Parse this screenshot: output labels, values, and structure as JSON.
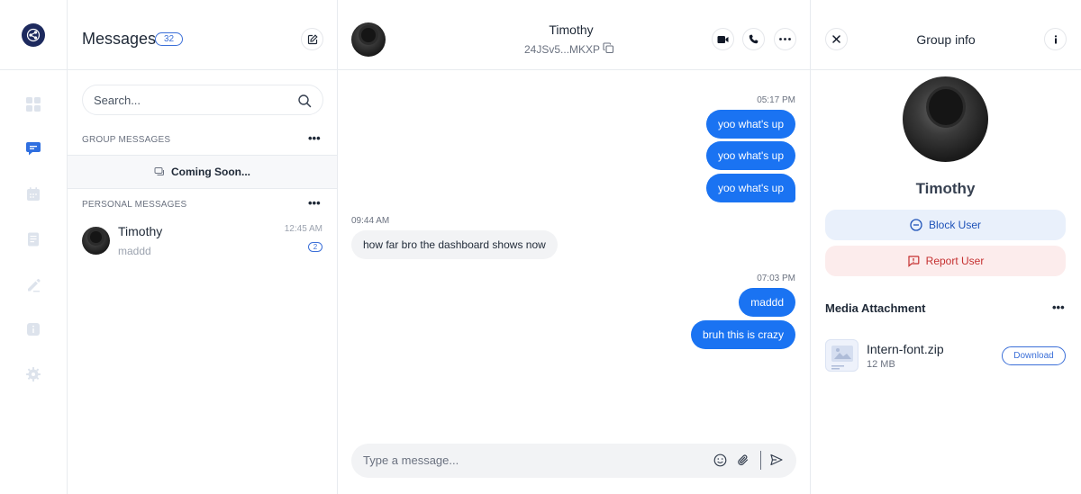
{
  "messages_panel": {
    "title": "Messages",
    "count": "32",
    "search_placeholder": "Search...",
    "group_section_label": "GROUP MESSAGES",
    "group_coming_soon": "Coming Soon...",
    "personal_section_label": "PERSONAL MESSAGES",
    "more_label": "•••",
    "conversations": [
      {
        "name": "Timothy",
        "preview": "maddd",
        "time": "12:45 AM",
        "unread": "2"
      }
    ]
  },
  "chat": {
    "contact_name": "Timothy",
    "contact_id": "24JSv5...MKXP",
    "input_placeholder": "Type a message...",
    "messages": [
      {
        "time": "05:17 PM",
        "direction": "out",
        "text": "yoo what's up"
      },
      {
        "direction": "out",
        "text": "yoo what's up"
      },
      {
        "direction": "out",
        "text": "yoo what's up"
      },
      {
        "time": "09:44 AM",
        "direction": "in",
        "text": "how far bro the dashboard shows now"
      },
      {
        "time": "07:03 PM",
        "direction": "out",
        "text": "maddd"
      },
      {
        "direction": "out",
        "text": "bruh this is crazy"
      }
    ]
  },
  "info_panel": {
    "title": "Group info",
    "profile_name": "Timothy",
    "block_label": "Block User",
    "report_label": "Report User",
    "media_title": "Media Attachment",
    "more_label": "•••",
    "attachments": [
      {
        "name": "Intern-font.zip",
        "size": "12 MB",
        "action": "Download"
      }
    ]
  },
  "icons": {
    "rail": [
      "app-logo-icon",
      "dashboard-icon",
      "messages-icon",
      "calendar-icon",
      "document-icon",
      "edit-icon",
      "info-icon",
      "settings-icon"
    ],
    "header": [
      "compose-icon",
      "video-call-icon",
      "phone-icon",
      "more-icon",
      "close-icon",
      "info-icon",
      "copy-icon"
    ],
    "composer": [
      "emoji-icon",
      "attach-icon",
      "send-icon"
    ]
  },
  "colors": {
    "accent": "#1a73f2",
    "rail_active": "#2f6fe0",
    "rail_inactive": "#dde3ec",
    "block_bg": "#e9f0fb",
    "report_bg": "#fcecec",
    "report_text": "#c53030"
  }
}
